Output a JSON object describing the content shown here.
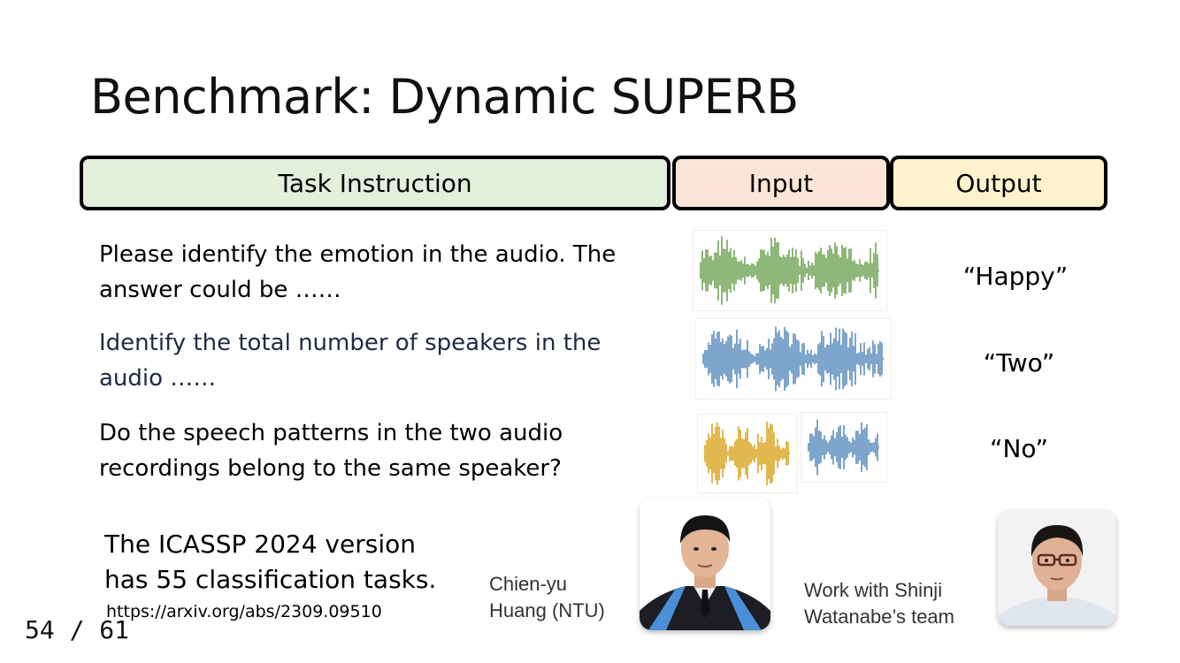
{
  "slide": {
    "title": "Benchmark: Dynamic SUPERB",
    "page_indicator": "54 / 61"
  },
  "headers": {
    "task": "Task Instruction",
    "input": "Input",
    "output": "Output"
  },
  "rows": [
    {
      "instruction_lines": [
        "Please identify the emotion in the audio. The",
        "answer could be ……"
      ],
      "output": "“Happy”",
      "wave_color": "#8fb77a"
    },
    {
      "instruction_lines": [
        "Identify the total number of speakers in the",
        "audio ……"
      ],
      "output": "“Two”",
      "wave_color": "#7ea6cc"
    },
    {
      "instruction_lines": [
        "Do the speech patterns in the two audio",
        "recordings belong to the same speaker?"
      ],
      "output": "“No”",
      "wave_color": "#e0b84f",
      "wave_color_2": "#7ea6cc"
    }
  ],
  "note": {
    "lines": [
      "The ICASSP 2024 version",
      "has 55 classification tasks."
    ],
    "link": "https://arxiv.org/abs/2309.09510"
  },
  "people": {
    "person1_lines": [
      "Chien-yu",
      "Huang (NTU)"
    ],
    "person2_lines": [
      "Work with Shinji",
      "Watanabe’s team"
    ]
  }
}
